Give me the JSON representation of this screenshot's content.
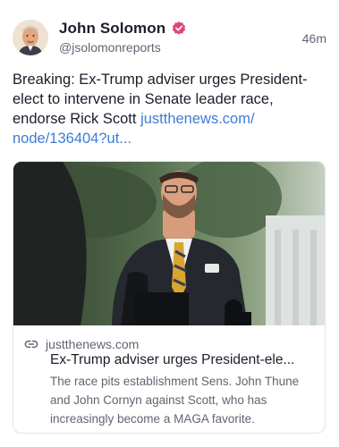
{
  "post": {
    "author_name": "John Solomon",
    "author_handle": "@jsolomonreports",
    "timestamp": "46m",
    "verified_color": "#e0457b",
    "text": "Breaking: Ex-Trump adviser urges President-elect to intervene in Senate leader race, endorse Rick Scott ",
    "link_text": "justthenews.com/ node/136404?ut..."
  },
  "card": {
    "domain": "justthenews.com",
    "title": "Ex-Trump adviser urges President-ele...",
    "description": "The race pits establishment Sens. John Thune and John Cornyn against Scott, who has increasingly become a MAGA favorite.",
    "link_icon": "link-icon"
  },
  "colors": {
    "link": "#3d7cd6",
    "text": "#1b1e2a",
    "muted": "#5f6572"
  }
}
